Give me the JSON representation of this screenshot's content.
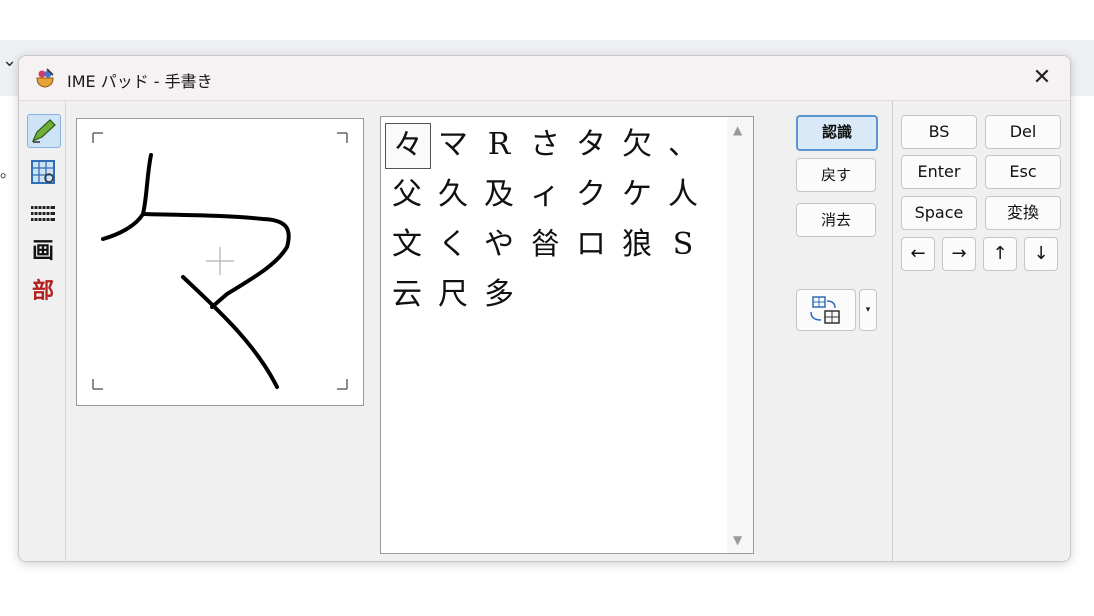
{
  "window": {
    "title": "IME パッド - 手書き",
    "close_label": "✕"
  },
  "toolbar": {
    "items": [
      {
        "name": "handwriting",
        "glyph": "✍",
        "active": true
      },
      {
        "name": "character-list",
        "glyph": "▦",
        "active": false
      },
      {
        "name": "soft-keyboard",
        "glyph": "⌨",
        "active": false
      },
      {
        "name": "stroke-count",
        "glyph": "画",
        "active": false
      },
      {
        "name": "radical",
        "glyph": "部",
        "active": false
      }
    ]
  },
  "drawing": {
    "center_mark": "+"
  },
  "candidates": {
    "rows": [
      [
        "々",
        "マ",
        "R",
        "さ",
        "タ",
        "欠",
        "、"
      ],
      [
        "父",
        "久",
        "及",
        "ィ",
        "ク",
        "ケ",
        "人"
      ],
      [
        "文",
        "く",
        "や",
        "㫺",
        "ロ",
        "狼",
        "S"
      ],
      [
        "云",
        "尺",
        "多"
      ]
    ],
    "selected": "々",
    "scroll_up": "▲",
    "scroll_down": "▼"
  },
  "commands": {
    "recognize_label": "認識",
    "undo_label": "戻す",
    "clear_label": "消去",
    "dropdown_glyph": "▾"
  },
  "keys": {
    "bs": "BS",
    "del": "Del",
    "enter": "Enter",
    "esc": "Esc",
    "space": "Space",
    "convert": "変換",
    "left": "←",
    "right": "→",
    "up": "↑",
    "down": "↓"
  },
  "colors": {
    "accent": "#5a96d4",
    "active_bg": "#d9e9f8"
  }
}
